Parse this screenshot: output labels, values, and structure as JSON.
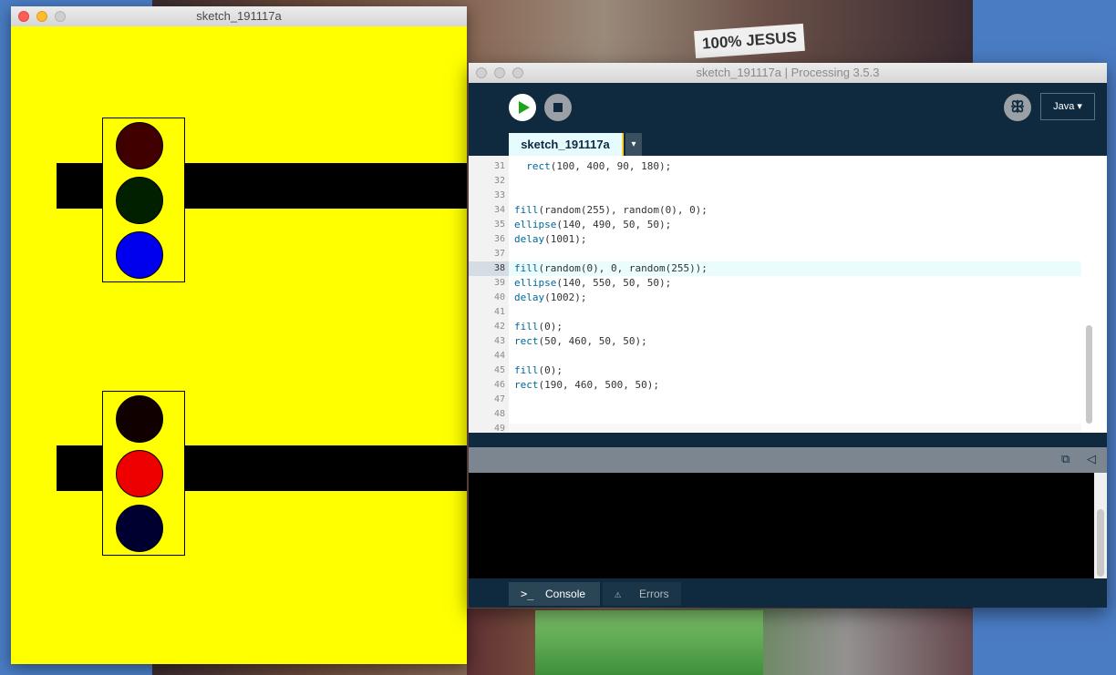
{
  "sketch_window": {
    "title": "sketch_191117a",
    "background_color": "#ffff00",
    "light_colors": {
      "top_red": "#400000",
      "top_green": "#002000",
      "top_blue": "#0000ee",
      "bottom_red": "#100000",
      "bottom_green": "#ee0000",
      "bottom_blue": "#000030"
    }
  },
  "ide": {
    "title": "sketch_191117a | Processing 3.5.3",
    "mode_label": "Java ▾",
    "tab_label": "sketch_191117a",
    "tab_menu_label": "▾",
    "code_lines": [
      {
        "num": "31",
        "pre": "  ",
        "kw": "rect",
        "rest": "(100, 400, 90, 180);"
      },
      {
        "num": "32",
        "pre": "",
        "kw": "",
        "rest": ""
      },
      {
        "num": "33",
        "pre": "",
        "kw": "",
        "rest": ""
      },
      {
        "num": "34",
        "pre": "",
        "kw": "fill",
        "rest": "(random(255), random(0), 0);"
      },
      {
        "num": "35",
        "pre": "",
        "kw": "ellipse",
        "rest": "(140, 490, 50, 50);"
      },
      {
        "num": "36",
        "pre": "",
        "kw": "delay",
        "rest": "(1001);"
      },
      {
        "num": "37",
        "pre": "",
        "kw": "",
        "rest": ""
      },
      {
        "num": "38",
        "pre": "",
        "kw": "fill",
        "rest": "(random(0), 0, random(255));"
      },
      {
        "num": "39",
        "pre": "",
        "kw": "ellipse",
        "rest": "(140, 550, 50, 50);"
      },
      {
        "num": "40",
        "pre": "",
        "kw": "delay",
        "rest": "(1002);"
      },
      {
        "num": "41",
        "pre": "",
        "kw": "",
        "rest": ""
      },
      {
        "num": "42",
        "pre": "",
        "kw": "fill",
        "rest": "(0);"
      },
      {
        "num": "43",
        "pre": "",
        "kw": "rect",
        "rest": "(50, 460, 50, 50);"
      },
      {
        "num": "44",
        "pre": "",
        "kw": "",
        "rest": ""
      },
      {
        "num": "45",
        "pre": "",
        "kw": "fill",
        "rest": "(0);"
      },
      {
        "num": "46",
        "pre": "",
        "kw": "rect",
        "rest": "(190, 460, 500, 50);"
      },
      {
        "num": "47",
        "pre": "",
        "kw": "",
        "rest": ""
      },
      {
        "num": "48",
        "pre": "",
        "kw": "",
        "rest": ""
      },
      {
        "num": "49",
        "pre": "",
        "kw": "",
        "rest": ""
      }
    ],
    "current_line": "38",
    "console_tab": "Console",
    "errors_tab": "Errors",
    "console_icon": ">_",
    "errors_icon": "⚠"
  },
  "wallpaper": {
    "headband_text": "100% JESUS"
  }
}
